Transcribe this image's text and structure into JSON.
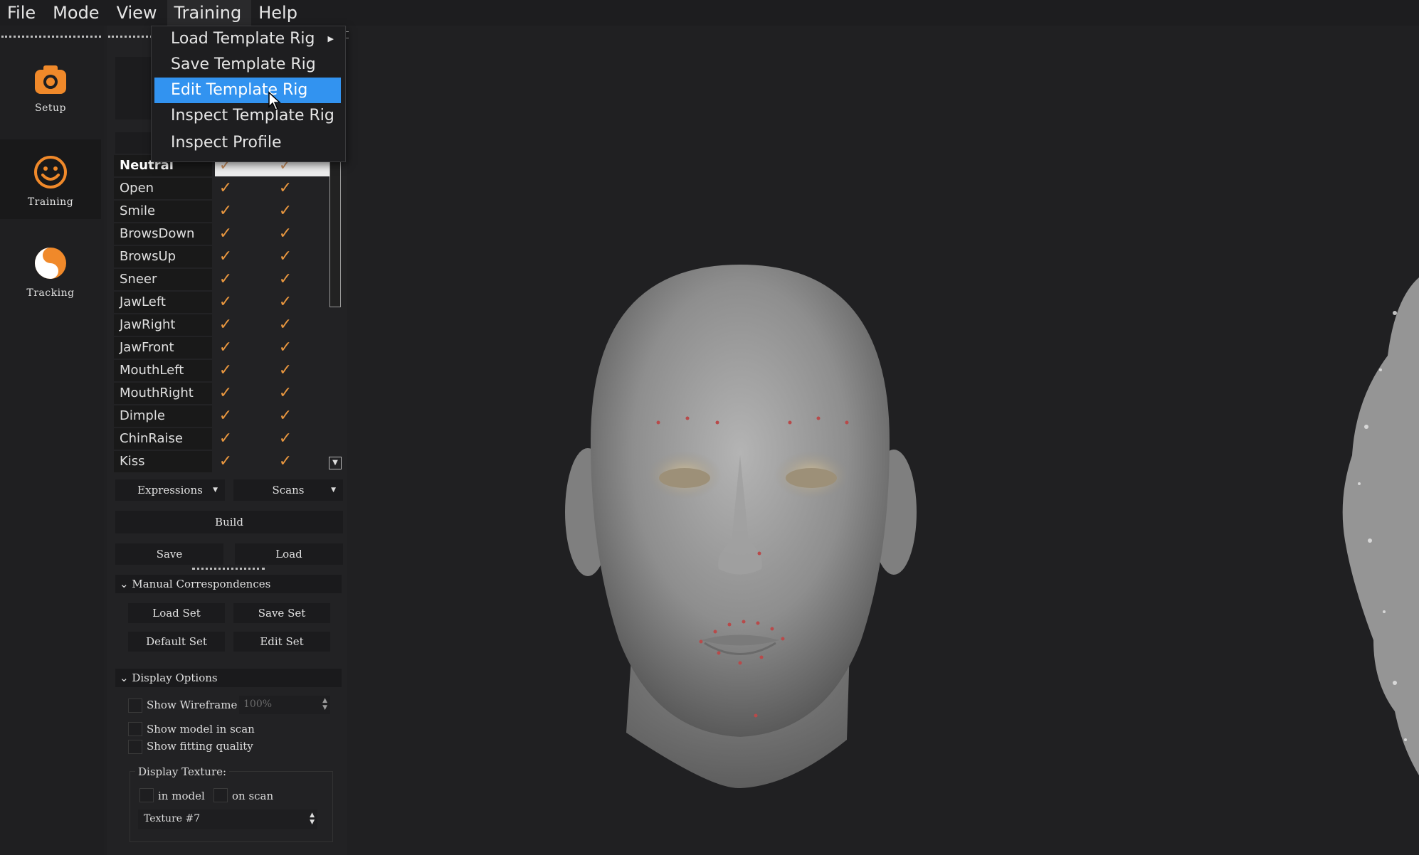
{
  "menubar": {
    "items": [
      "File",
      "Mode",
      "View",
      "Training",
      "Help"
    ]
  },
  "training_menu": {
    "items": [
      {
        "label": "Load Template Rig",
        "submenu": true
      },
      {
        "label": "Save Template Rig",
        "submenu": false
      },
      {
        "label": "Edit Template Rig",
        "submenu": false,
        "highlighted": true
      },
      {
        "label": "Inspect Template Rig",
        "submenu": false
      },
      {
        "label": "Inspect Profile",
        "submenu": false
      }
    ]
  },
  "rail": {
    "setup": "Setup",
    "training": "Training",
    "tracking": "Tracking",
    "accent": "#f0892a"
  },
  "expressions": {
    "rows": [
      {
        "name": "Neutral",
        "bold": true,
        "selected": true,
        "c1": "✓",
        "c2": "✓"
      },
      {
        "name": "Open",
        "c1": "✓",
        "c2": "✓"
      },
      {
        "name": "Smile",
        "c1": "✓",
        "c2": "✓"
      },
      {
        "name": "BrowsDown",
        "c1": "✓",
        "c2": "✓"
      },
      {
        "name": "BrowsUp",
        "c1": "✓",
        "c2": "✓"
      },
      {
        "name": "Sneer",
        "c1": "✓",
        "c2": "✓"
      },
      {
        "name": "JawLeft",
        "c1": "✓",
        "c2": "✓"
      },
      {
        "name": "JawRight",
        "c1": "✓",
        "c2": "✓"
      },
      {
        "name": "JawFront",
        "c1": "✓",
        "c2": "✓"
      },
      {
        "name": "MouthLeft",
        "c1": "✓",
        "c2": "✓"
      },
      {
        "name": "MouthRight",
        "c1": "✓",
        "c2": "✓"
      },
      {
        "name": "Dimple",
        "c1": "✓",
        "c2": "✓"
      },
      {
        "name": "ChinRaise",
        "c1": "✓",
        "c2": "✓"
      },
      {
        "name": "Kiss",
        "c1": "✓",
        "c2": "✓"
      }
    ],
    "check_color": "#e9973f"
  },
  "controls": {
    "expressions_combo": "Expressions",
    "scans_combo": "Scans",
    "build": "Build",
    "save": "Save",
    "load": "Load"
  },
  "manual_correspondences": {
    "title": "Manual Correspondences",
    "load_set": "Load Set",
    "save_set": "Save Set",
    "default_set": "Default Set",
    "edit_set": "Edit Set"
  },
  "display_options": {
    "title": "Display Options",
    "show_wireframe": "Show Wireframe",
    "wireframe_value": "100%",
    "show_model_in_scan": "Show model in scan",
    "show_fitting_quality": "Show fitting quality",
    "display_texture_label": "Display Texture:",
    "in_model": "in model",
    "on_scan": "on scan",
    "texture_value": "Texture #7"
  }
}
